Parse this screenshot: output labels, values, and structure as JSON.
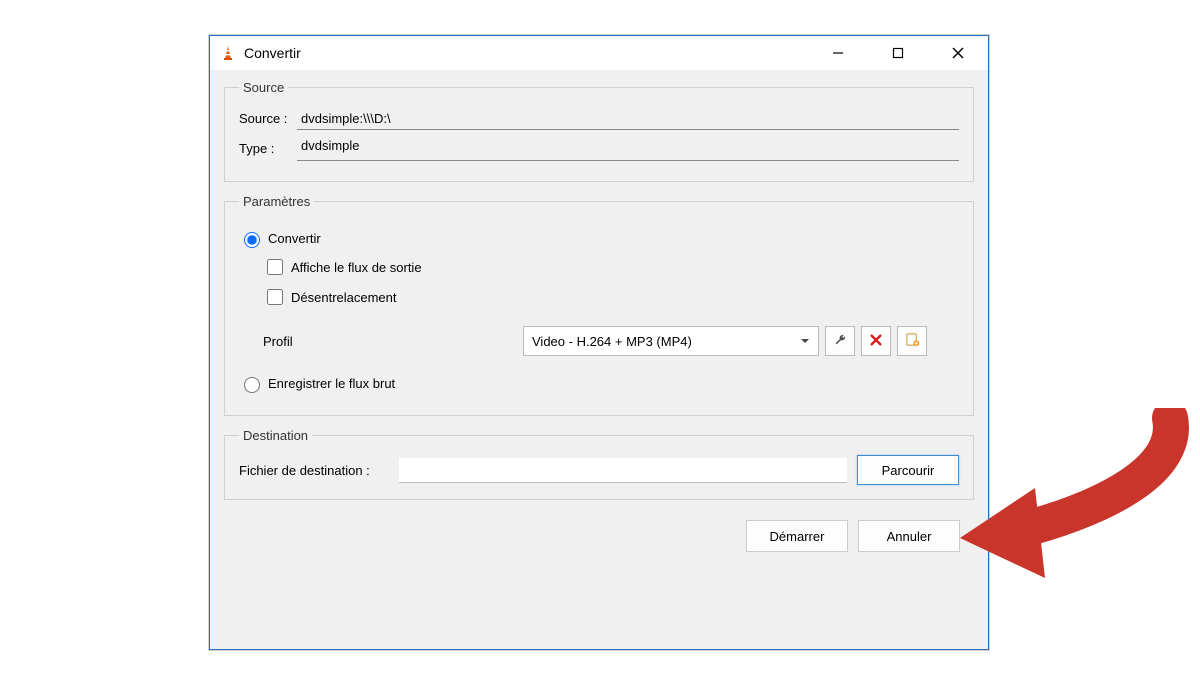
{
  "window": {
    "title": "Convertir"
  },
  "source": {
    "legend": "Source",
    "source_label": "Source :",
    "source_value": "dvdsimple:\\\\\\D:\\",
    "type_label": "Type :",
    "type_value": "dvdsimple"
  },
  "params": {
    "legend": "Paramètres",
    "convert_label": "Convertir",
    "show_output_label": "Affiche le flux de sortie",
    "deinterlace_label": "Désentrelacement",
    "profile_label": "Profil",
    "profile_selected": "Video - H.264 + MP3 (MP4)",
    "dump_raw_label": "Enregistrer le flux brut"
  },
  "destination": {
    "legend": "Destination",
    "file_label": "Fichier de destination :",
    "file_value": "",
    "browse_label": "Parcourir"
  },
  "footer": {
    "start_label": "Démarrer",
    "cancel_label": "Annuler"
  },
  "icons": {
    "wrench": "wrench-icon",
    "delete": "delete-icon",
    "new": "new-profile-icon"
  }
}
